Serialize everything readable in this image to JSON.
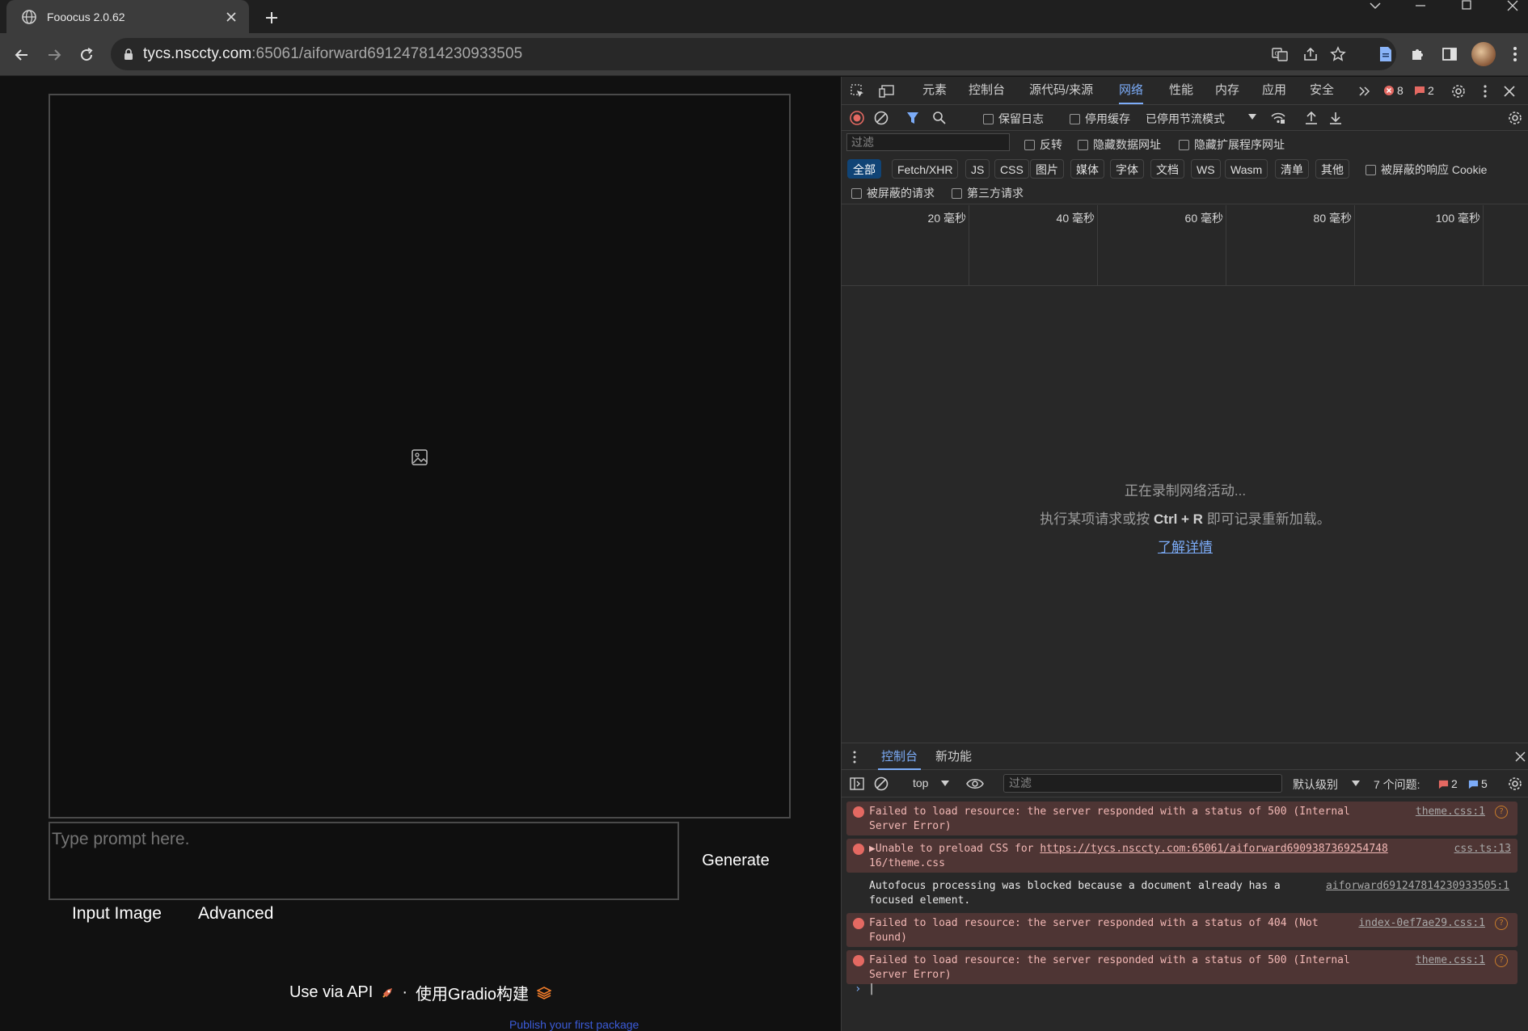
{
  "browser": {
    "tab_title": "Fooocus 2.0.62",
    "url_host": "tycs.nsccty.com",
    "url_path": ":65061/aiforward691247814230933505"
  },
  "page": {
    "prompt_placeholder": "Type prompt here.",
    "generate_label": "Generate",
    "tabs": [
      "Input Image",
      "Advanced"
    ],
    "footer_api": "Use via API",
    "footer_sep": "·",
    "footer_gradio": "使用Gradio构建",
    "publish_text": "Publish your first package"
  },
  "devtools": {
    "tabs": [
      "元素",
      "控制台",
      "源代码/来源",
      "网络",
      "性能",
      "内存",
      "应用",
      "安全"
    ],
    "active_tab": "网络",
    "error_count": "8",
    "issue_count": "2",
    "toolbar": {
      "preserve_log": "保留日志",
      "disable_cache": "停用缓存",
      "throttle": "已停用节流模式"
    },
    "filter_placeholder": "过滤",
    "filter_options": [
      "反转",
      "隐藏数据网址",
      "隐藏扩展程序网址"
    ],
    "types": [
      "全部",
      "Fetch/XHR",
      "JS",
      "CSS",
      "图片",
      "媒体",
      "字体",
      "文档",
      "WS",
      "Wasm",
      "清单",
      "其他"
    ],
    "blocked_cookies": "被屏蔽的响应 Cookie",
    "blocked_requests": "被屏蔽的请求",
    "third_party": "第三方请求",
    "timeline_ticks": [
      "20 毫秒",
      "40 毫秒",
      "60 毫秒",
      "80 毫秒",
      "100 毫秒"
    ],
    "empty_line1": "正在录制网络活动...",
    "empty_line2_pre": "执行某项请求或按",
    "empty_line2_key": "Ctrl + R",
    "empty_line2_post": "即可记录重新加载。",
    "learn_more": "了解详情",
    "drawer_tabs": [
      "控制台",
      "新功能"
    ],
    "console_context": "top",
    "console_filter": "过滤",
    "log_level": "默认级别",
    "issues_label": "7 个问题:",
    "issues_errors": "2",
    "issues_info": "5",
    "messages": [
      {
        "type": "error",
        "text": "Failed to load resource: the server responded with a status of 500 (Internal Server Error)",
        "source": "theme.css:1"
      },
      {
        "type": "error",
        "text_pre": "▶Unable to preload CSS for ",
        "link": "https://tycs.nsccty.com:65061/aiforward6909387369254748",
        "text_post": "16/theme.css",
        "source": "css.ts:13"
      },
      {
        "type": "info",
        "text": "Autofocus processing was blocked because a document already has a focused element.",
        "source": "aiforward691247814230933505:1"
      },
      {
        "type": "error",
        "text": "Failed to load resource: the server responded with a status of 404 (Not Found)",
        "source": "index-0ef7ae29.css:1"
      },
      {
        "type": "error",
        "text": "Failed to load resource: the server responded with a status of 500 (Internal Server Error)",
        "source": "theme.css:1"
      }
    ]
  }
}
